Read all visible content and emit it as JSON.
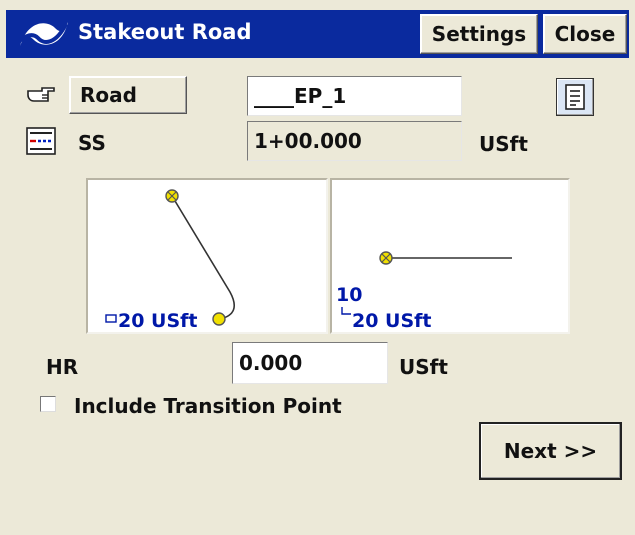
{
  "window": {
    "title": "Stakeout Road",
    "settings_label": "Settings",
    "close_label": "Close"
  },
  "road": {
    "button_label": "Road",
    "value": "____EP_1"
  },
  "ss": {
    "label": "SS",
    "value": "1+00.000",
    "unit": "USft"
  },
  "plan_view": {
    "scale_text": "20 USft"
  },
  "section_view": {
    "value_text": "10",
    "scale_text": "20 USft"
  },
  "hr": {
    "label": "HR",
    "value": "0.000",
    "unit": "USft"
  },
  "transition": {
    "label": "Include Transition Point",
    "checked": false
  },
  "next_label": "Next >>",
  "colors": {
    "titlebar": "#0a2a9e",
    "accent_text": "#0018a8",
    "point_fill": "#f1e000",
    "background": "#ece9d8"
  },
  "icons": [
    "app-logo-icon",
    "pointing-hand-icon",
    "ss-icon",
    "list-document-icon",
    "checkbox-icon"
  ]
}
